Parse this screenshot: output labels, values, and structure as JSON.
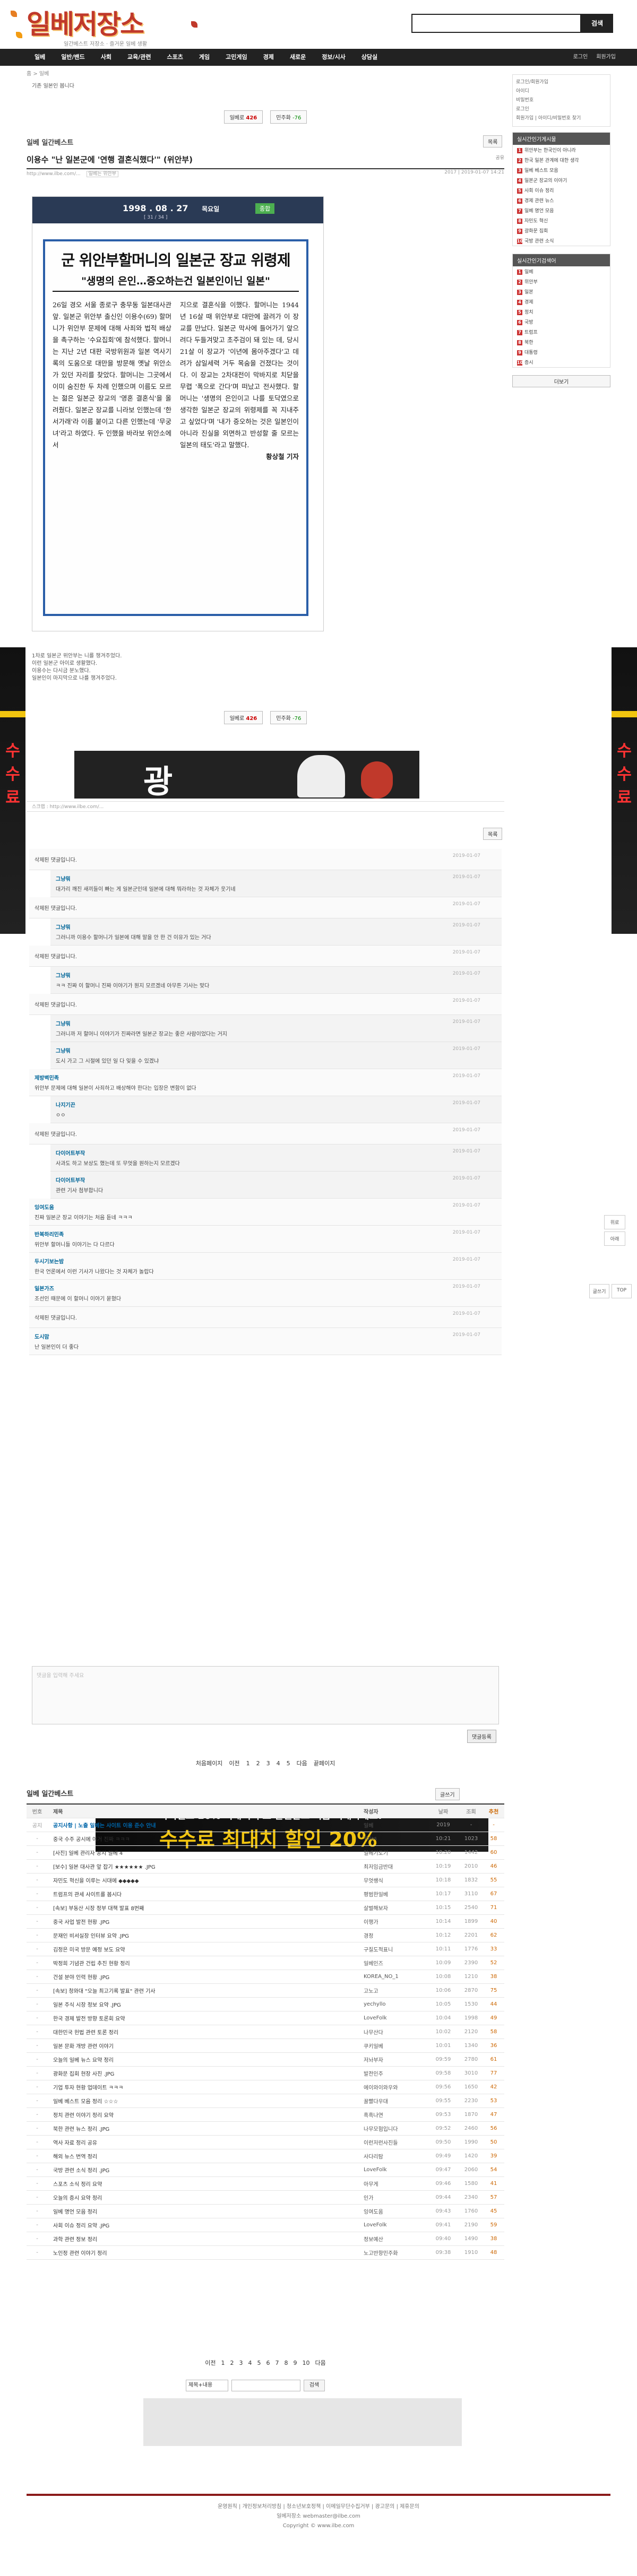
{
  "site": {
    "logo": "일베저장소",
    "tagline": "일간베스트 저장소 · 즐거운 일베 생활",
    "search_btn": "검색"
  },
  "nav": {
    "items": [
      "일베",
      "일반/밴드",
      "사회",
      "교육/관련",
      "스포츠",
      "게임",
      "고민게임",
      "경제",
      "새로운",
      "정보/시사",
      "상담실"
    ],
    "right": [
      "로그인",
      "회원가입"
    ]
  },
  "breadcrumb": "홈 > 일베",
  "top_note": "기존 일본인 봅니다",
  "vote": {
    "up_label": "일베로",
    "up_count": "426",
    "down_label": "민주화",
    "down_count": "-76"
  },
  "board": {
    "title": "일베 일간베스트",
    "list_btn": "목록"
  },
  "post": {
    "title": "이용수 \"난 일본군에 '연행 결혼식했다'\" (위안부)",
    "meta_left": "http://www.ilbe.com/...",
    "tag": "일베는 위안부",
    "meta_right": "2017 | 2019-01-07 14:21",
    "share": "공유",
    "clip_date": "1998 . 08 . 27",
    "clip_day": "목요일",
    "clip_tag": "종합",
    "clip_edition": "[ 31 / 34 ]",
    "headline": "군 위안부할머니의 일본군 장교 위령제",
    "subhead": "\"생명의 은인…증오하는건 일본인이닌 일본\"",
    "col1": "26일 경오 서울 종로구 충무동 일본대사관 앞. 일본군 위안부 출신인 이용수(69) 할머니가 위안부 문제에 대해 사죄와 법적 배상을 촉구하는 '수요집회'에 참석했다. 할머니는 지난 2년 대판 국방위원과 일본 역사기록의 도움으로 대만을 방문해 옛날 위안소가 있던 자리를 찾았다. 할머니는 그곳에서 이미 숨진한 두 차례 인했으며 이름도 모르는 젊은 일본군 장교의 '영혼 결혼식'을 올려줬다. 일본군 장교를 니라보 인했는데 '한서가래'라 이름 붙이고 다른 인했는데 '무궁녀'라고 하였다. 두 인했을 바라보 위안소에서",
    "col2": "지으로 결혼식을 이했다. 할머니는 1944년 16살 때 위안부로 대만에 끌려가 이 장교를 만났다. 일본군 막사에 들어가기 앞으려다 두들겨맞고 초주검이 돼 있는 데, 당시 21살 이 장교가 '이년에 몸아주겠다'고 데려가 삼일세력 거두 목숨을 건졌다는 것이다. 이 장교는 2차대전이 막바지로 치닫을 무렵 '폭으로 간다'며 떠났고 전사했다. 할머니는 '생명의 은인이고 나를 토닥였으로 생각한 일본군 장교의 위령제를 꼭 지내주고 싶었다'며 '내가 증오하는 것은 일본인이 아니라 진실을 외면하고 반성할 줄 모르는 일본의 태도'라고 말했다.",
    "byline": "황상철 기자",
    "after": [
      "1차로 일본군 위안부는 니를 챙겨주었다.",
      "이런 일본군 아이로 생활했다.",
      "이용수는 다시금 분노했다.",
      "일본인이 마지막으로 나를 챙겨주었다."
    ]
  },
  "banner1": {
    "text": "광"
  },
  "url_line": "스크랩 : http://www.ilbe.com/...",
  "comments": [
    {
      "level": 0,
      "who": "",
      "text": "삭제된 댓글입니다.",
      "when": "2019-01-07"
    },
    {
      "level": 1,
      "who": "그냥뭐",
      "text": "대가리 깨진 새끼들이 빠는 게 일본군인데 일본에 대해 뭐라하는 것 자체가 웃기네",
      "when": "2019-01-07"
    },
    {
      "level": 0,
      "who": "",
      "text": "삭제된 댓글입니다.",
      "when": "2019-01-07"
    },
    {
      "level": 1,
      "who": "그냥뭐",
      "text": "그러니까 이용수 할머니가 일본에 대해 말을 안 한 건 이유가 있는 거다",
      "when": "2019-01-07"
    },
    {
      "level": 0,
      "who": "",
      "text": "삭제된 댓글입니다.",
      "when": "2019-01-07"
    },
    {
      "level": 1,
      "who": "그냥뭐",
      "text": "ㅋㅋ 진짜 이 할머니 진짜 이야기가 뭔지 모르겠네 아무튼 기사는 맞다",
      "when": "2019-01-07"
    },
    {
      "level": 0,
      "who": "",
      "text": "삭제된 댓글입니다.",
      "when": "2019-01-07"
    },
    {
      "level": 1,
      "who": "그냥뭐",
      "text": "그러니까 저 할머니 이야기가 진짜라면 일본군 장교는 좋은 사람이었다는 거지",
      "when": "2019-01-07"
    },
    {
      "level": 1,
      "who": "그냥뭐",
      "text": "도시 가고 그 시절에 있던 일 다 잊을 수 있겠냐",
      "when": "2019-01-07"
    },
    {
      "level": 0,
      "who": "제방벽민족",
      "text": "위안부 문제에 대해 일본이 사죄하고 배상해야 한다는 입장은 변함이 없다",
      "when": "2019-01-07"
    },
    {
      "level": 1,
      "who": "나지기끈",
      "text": "ㅇㅇ",
      "when": "2019-01-07"
    },
    {
      "level": 0,
      "who": "",
      "text": "삭제된 댓글입니다.",
      "when": "2019-01-07"
    },
    {
      "level": 1,
      "who": "다이어트부작",
      "text": "사과도 하고 보상도 했는데 또 무엇을 원하는지 모르겠다",
      "when": "2019-01-07"
    },
    {
      "level": 1,
      "who": "다이어트부작",
      "text": "관련 기사 첨부합니다",
      "when": "2019-01-07"
    },
    {
      "level": 0,
      "who": "잉여도움",
      "text": "진짜 일본군 장교 이야기는 처음 듣네 ㅋㅋㅋ",
      "when": "2019-01-07"
    },
    {
      "level": 0,
      "who": "반복하리민족",
      "text": "위안부 할머니들 이야기는 다 다르다",
      "when": "2019-01-07"
    },
    {
      "level": 0,
      "who": "두시기보는밤",
      "text": "한국 언론에서 이런 기사가 나왔다는 것 자체가 놀랍다",
      "when": "2019-01-07"
    },
    {
      "level": 0,
      "who": "일본가즈",
      "text": "조선인 때문에 이 할머니 이야기 묻혔다",
      "when": "2019-01-07"
    },
    {
      "level": 0,
      "who": "",
      "text": "삭제된 댓글입니다.",
      "when": "2019-01-07"
    },
    {
      "level": 0,
      "who": "도시맘",
      "text": "난 일본인이 더 좋다",
      "when": "2019-01-07"
    }
  ],
  "comment_box": {
    "placeholder": "댓글을 입력해 주세요",
    "submit": "댓글등록"
  },
  "pager": [
    "처음페이지",
    "이전",
    "1",
    "2",
    "3",
    "4",
    "5",
    "다음",
    "끝페이지"
  ],
  "banner2": {
    "line1": "바이낸스 20% 최대 수수료 할인받고 지금 거래하세요!",
    "line2": "수수료 최대치 할인 20%"
  },
  "list": {
    "title": "일베 일간베스트",
    "write": "글쓰기",
    "headers": [
      "번호",
      "제목",
      "작성자",
      "날짜",
      "조회",
      "추천"
    ],
    "rows": [
      {
        "no": "공지",
        "t": "공지사항 | 노출 일베는 사이트 이용 준수 안내",
        "n": "일베",
        "d": "2019",
        "v": "-",
        "r": "-",
        "notice": true
      },
      {
        "no": "-",
        "t": "중국 수주 공시에 이거 진짜 ㅋㅋㅋ",
        "n": "Yolas",
        "d": "10:21",
        "v": "1023",
        "r": "58"
      },
      {
        "no": "-",
        "t": "[사진] 일베 관리자 공지 일베 4",
        "n": "얼베기도기",
        "d": "10:20",
        "v": "1442",
        "r": "60"
      },
      {
        "no": "-",
        "t": "[보수] 일본 대사관 앞 잡기 ★★★★★★ .JPG",
        "n": "최저임금반대",
        "d": "10:19",
        "v": "2010",
        "r": "46"
      },
      {
        "no": "-",
        "t": "자민도 혁신을 이루는 시대에 ◆◆◆◆◆",
        "n": "무엇쌩식",
        "d": "10:18",
        "v": "1832",
        "r": "55"
      },
      {
        "no": "-",
        "t": "트럼프의 관세 사이트를 봅시다",
        "n": "평범한일베",
        "d": "10:17",
        "v": "3110",
        "r": "67"
      },
      {
        "no": "-",
        "t": "[속보] 부동산 시장 정부 대책 발표 8번째",
        "n": "살벌해보자",
        "d": "10:15",
        "v": "2540",
        "r": "71"
      },
      {
        "no": "-",
        "t": "중국 사업 발전 현황 .JPG",
        "n": "이행가",
        "d": "10:14",
        "v": "1899",
        "r": "40"
      },
      {
        "no": "-",
        "t": "문재인 비서실장 인터뷰 요약 .JPG",
        "n": "경정",
        "d": "10:12",
        "v": "2201",
        "r": "62"
      },
      {
        "no": "-",
        "t": "김정은 미국 방문 예정 보도 요약",
        "n": "구질도적표니",
        "d": "10:11",
        "v": "1776",
        "r": "33"
      },
      {
        "no": "-",
        "t": "박정희 기념관 건립 추진 현황 정리",
        "n": "일베인즈",
        "d": "10:09",
        "v": "2390",
        "r": "52"
      },
      {
        "no": "-",
        "t": "건설 분야 인력 현황 .JPG",
        "n": "KOREA_NO_1",
        "d": "10:08",
        "v": "1210",
        "r": "38"
      },
      {
        "no": "-",
        "t": "[속보] 청와대 \"오늘 최고기록 발표\" 관련 기사",
        "n": "고노고",
        "d": "10:06",
        "v": "2870",
        "r": "75"
      },
      {
        "no": "-",
        "t": "일본 주식 시장 정보 요약 .JPG",
        "n": "yechyllo",
        "d": "10:05",
        "v": "1530",
        "r": "44"
      },
      {
        "no": "-",
        "t": "한국 경제 발전 방향 토론회 요약",
        "n": "LoveFolk",
        "d": "10:04",
        "v": "1998",
        "r": "49"
      },
      {
        "no": "-",
        "t": "대한민국 헌법 관련 토론 정리",
        "n": "나무산다",
        "d": "10:02",
        "v": "2120",
        "r": "58"
      },
      {
        "no": "-",
        "t": "일본 문화 개방 관련 이야기",
        "n": "쿠키일베",
        "d": "10:01",
        "v": "1340",
        "r": "36"
      },
      {
        "no": "-",
        "t": "오늘의 일베 뉴스 요약 정리",
        "n": "저놔부자",
        "d": "09:59",
        "v": "2780",
        "r": "61"
      },
      {
        "no": "-",
        "t": "광화문 집회 현장 사진 .JPG",
        "n": "발전인주",
        "d": "09:58",
        "v": "3010",
        "r": "77"
      },
      {
        "no": "-",
        "t": "기업 투자 현황 업데이트 ㅋㅋㅋ",
        "n": "에이와이와우와",
        "d": "09:56",
        "v": "1650",
        "r": "42"
      },
      {
        "no": "-",
        "t": "일베 베스트 모음 정리 ☆☆☆",
        "n": "꿀빨다우대",
        "d": "09:55",
        "v": "2230",
        "r": "53"
      },
      {
        "no": "-",
        "t": "정치 관련 이야기 정리 요약",
        "n": "흑흑나연",
        "d": "09:53",
        "v": "1870",
        "r": "47"
      },
      {
        "no": "-",
        "t": "북한 관련 뉴스 정리 .JPG",
        "n": "나무모험입니다",
        "d": "09:52",
        "v": "2460",
        "r": "56"
      },
      {
        "no": "-",
        "t": "역사 자료 정리 공유",
        "n": "이런저런사진들",
        "d": "09:50",
        "v": "1990",
        "r": "50"
      },
      {
        "no": "-",
        "t": "해외 뉴스 번역 정리",
        "n": "사다리탐",
        "d": "09:49",
        "v": "1420",
        "r": "39"
      },
      {
        "no": "-",
        "t": "국방 관련 소식 정리 .JPG",
        "n": "LoveFolk",
        "d": "09:47",
        "v": "2060",
        "r": "54"
      },
      {
        "no": "-",
        "t": "스포츠 소식 정리 요약",
        "n": "아무게",
        "d": "09:46",
        "v": "1580",
        "r": "41"
      },
      {
        "no": "-",
        "t": "오늘의 증시 요약 정리",
        "n": "인가",
        "d": "09:44",
        "v": "2340",
        "r": "57"
      },
      {
        "no": "-",
        "t": "일베 명언 모음 정리",
        "n": "잉여도움",
        "d": "09:43",
        "v": "1760",
        "r": "45"
      },
      {
        "no": "-",
        "t": "사회 이슈 정리 요약 .JPG",
        "n": "LoveFolk",
        "d": "09:41",
        "v": "2190",
        "r": "59"
      },
      {
        "no": "-",
        "t": "과학 관련 정보 정리",
        "n": "정보예산",
        "d": "09:40",
        "v": "1490",
        "r": "38"
      },
      {
        "no": "-",
        "t": "노인정 관련 이야기 정리",
        "n": "노고반항민주화",
        "d": "09:38",
        "v": "1910",
        "r": "48"
      }
    ]
  },
  "list_pager": [
    "이전",
    "1",
    "2",
    "3",
    "4",
    "5",
    "6",
    "7",
    "8",
    "9",
    "10",
    "다음"
  ],
  "list_search": {
    "select": "제목+내용",
    "button": "검색"
  },
  "footer": {
    "links": "운영원칙 | 개인정보처리방침 | 청소년보호정책 | 이메일무단수집거부 | 광고문의 | 제휴문의",
    "contact": "일베저장소 webmaster@ilbe.com",
    "copy": "Copyright © www.ilbe.com"
  },
  "right": {
    "login": [
      "로그인/회원가입",
      "아이디",
      "비밀번호",
      "로그인",
      "회원가입 | 아이디/비밀번호 찾기"
    ],
    "popular_title": "실시간인기게시물",
    "popular": [
      "위안부는 한국인이 아니라",
      "한국 일본 관계에 대한 생각",
      "일베 베스트 모음",
      "일본군 장교의 이야기",
      "사회 이슈 정리",
      "경제 관련 뉴스",
      "일베 명언 모음",
      "자민도 혁신",
      "광화문 집회",
      "국방 관련 소식"
    ],
    "keyword_title": "실시간인기검색어",
    "keywords": [
      "일베",
      "위안부",
      "일본",
      "경제",
      "정치",
      "국방",
      "트럼프",
      "북한",
      "대통령",
      "증시"
    ],
    "more": "더보기"
  },
  "float": {
    "top": "TOP",
    "up": "위로",
    "down": "아래",
    "write": "글쓰기",
    "list": "목록"
  }
}
